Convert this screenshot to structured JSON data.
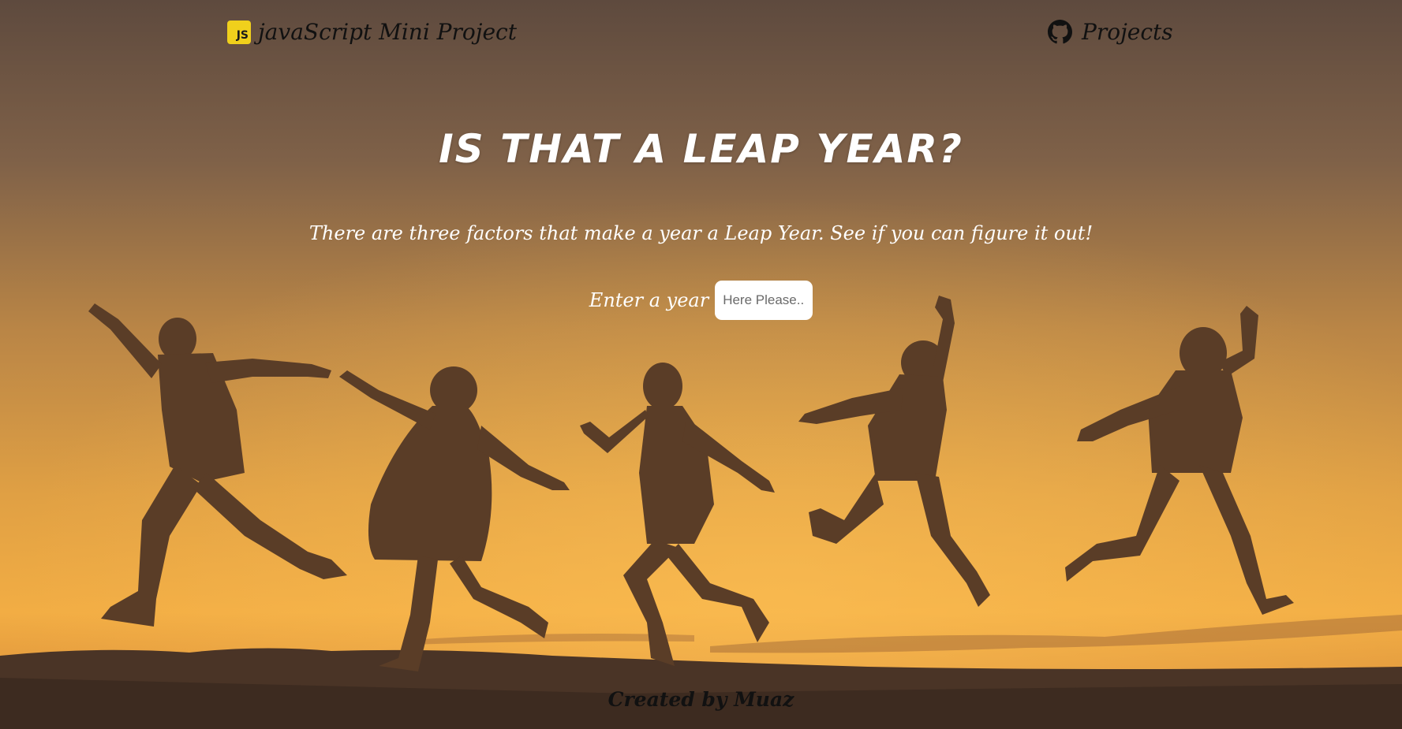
{
  "nav": {
    "brand_icon": "JS",
    "brand_title": "javaScript Mini Project",
    "projects_label": "Projects",
    "projects_icon": "github-icon"
  },
  "main": {
    "title": "IS THAT A LEAP YEAR?",
    "subtitle": "There are three factors that make a year a Leap Year. See if you can figure it out!",
    "input_label": "Enter a year",
    "input_placeholder": "Here Please...",
    "input_value": ""
  },
  "footer": {
    "credit": "Created by Muaz"
  },
  "colors": {
    "sky_top": "#5e4a3e",
    "sky_mid": "#d59240",
    "horizon": "#f1ae42",
    "silhouette": "#5a3d27",
    "js_yellow": "#f0d01c"
  },
  "icons": [
    "js-logo-icon",
    "github-icon"
  ]
}
